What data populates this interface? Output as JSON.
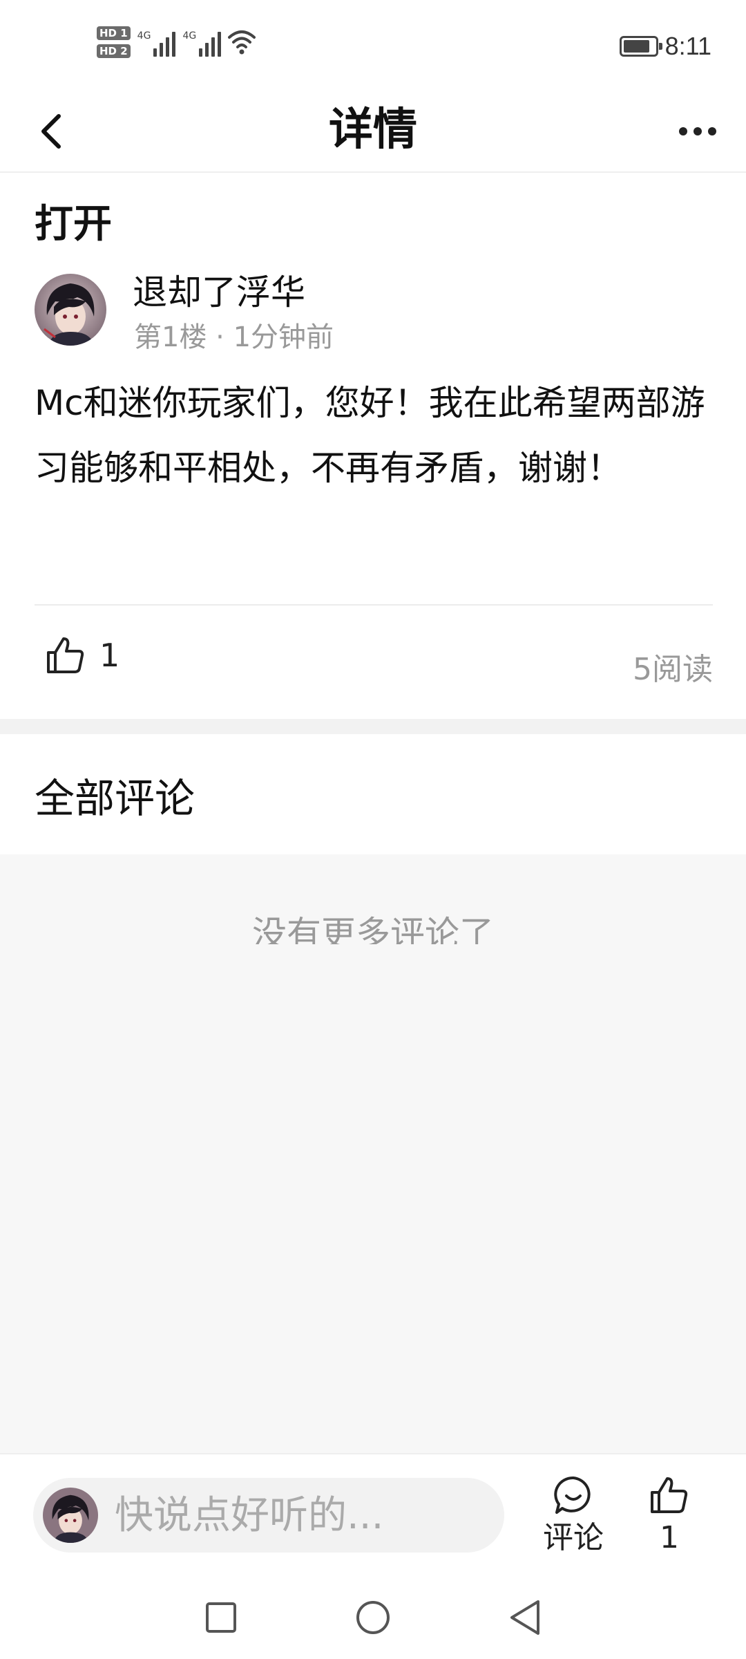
{
  "status_bar": {
    "sim1_label": "HD 1",
    "sim2_label": "HD 2",
    "network1": "4G",
    "network2": "4G",
    "battery_level": 0.85,
    "time": "8:11"
  },
  "header": {
    "title": "详情",
    "back_icon": "chevron-left-icon",
    "more_icon": "more-horizontal-icon"
  },
  "post": {
    "title": "打开",
    "author": "退却了浮华",
    "meta": "第1楼 · 1分钟前",
    "body": "Mc和迷你玩家们，您好！我在此希望两部游习能够和平相处，不再有矛盾，谢谢！",
    "like_count": "1",
    "read_count": "5阅读"
  },
  "comments": {
    "section_title": "全部评论",
    "empty_text": "没有更多评论了"
  },
  "bottom_bar": {
    "input_placeholder": "快说点好听的...",
    "comment_label": "评论",
    "like_count": "1"
  },
  "colors": {
    "text_primary": "#1a1a1a",
    "text_secondary": "#999999",
    "divider": "#ececec",
    "page_bg": "#f7f7f7"
  }
}
